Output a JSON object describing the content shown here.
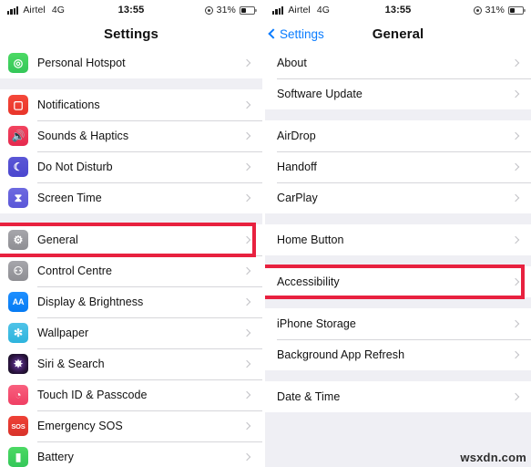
{
  "status_bar": {
    "signal_icon": "cellular-signal-icon",
    "carrier": "Airtel",
    "network": "4G",
    "time": "13:55",
    "location_icon": "location-services-icon",
    "battery_percent": "31%",
    "battery_level": 31,
    "battery_icon": "battery-icon"
  },
  "left_screen": {
    "nav": {
      "title": "Settings"
    },
    "groups": [
      {
        "rows": [
          {
            "label": "Personal Hotspot",
            "icon": "personal-hotspot-icon",
            "icon_class": "ic-hotspot",
            "glyph": "◎",
            "chevron": "chevron-right-icon"
          }
        ]
      },
      {
        "rows": [
          {
            "label": "Notifications",
            "icon": "notifications-icon",
            "icon_class": "ic-notif",
            "glyph": "▢",
            "chevron": "chevron-right-icon"
          },
          {
            "label": "Sounds & Haptics",
            "icon": "sounds-haptics-icon",
            "icon_class": "ic-sounds",
            "glyph": "🔊",
            "chevron": "chevron-right-icon"
          },
          {
            "label": "Do Not Disturb",
            "icon": "do-not-disturb-icon",
            "icon_class": "ic-dnd",
            "glyph": "☾",
            "chevron": "chevron-right-icon"
          },
          {
            "label": "Screen Time",
            "icon": "screen-time-icon",
            "icon_class": "ic-screentime",
            "glyph": "⧗",
            "chevron": "chevron-right-icon"
          }
        ]
      },
      {
        "rows": [
          {
            "label": "General",
            "icon": "general-icon",
            "icon_class": "ic-general",
            "glyph": "⚙",
            "chevron": "chevron-right-icon",
            "highlighted": true
          },
          {
            "label": "Control Centre",
            "icon": "control-centre-icon",
            "icon_class": "ic-control",
            "glyph": "⚇",
            "chevron": "chevron-right-icon"
          },
          {
            "label": "Display & Brightness",
            "icon": "display-brightness-icon",
            "icon_class": "ic-display",
            "glyph": "AA",
            "chevron": "chevron-right-icon"
          },
          {
            "label": "Wallpaper",
            "icon": "wallpaper-icon",
            "icon_class": "ic-wallpaper",
            "glyph": "✻",
            "chevron": "chevron-right-icon"
          },
          {
            "label": "Siri & Search",
            "icon": "siri-search-icon",
            "icon_class": "ic-siri",
            "glyph": "✸",
            "chevron": "chevron-right-icon"
          },
          {
            "label": "Touch ID & Passcode",
            "icon": "touch-id-passcode-icon",
            "icon_class": "ic-touchid",
            "glyph": "◔",
            "chevron": "chevron-right-icon"
          },
          {
            "label": "Emergency SOS",
            "icon": "emergency-sos-icon",
            "icon_class": "ic-sos",
            "glyph": "SOS",
            "chevron": "chevron-right-icon"
          },
          {
            "label": "Battery",
            "icon": "battery-settings-icon",
            "icon_class": "ic-battery",
            "glyph": "▮",
            "chevron": "chevron-right-icon",
            "partial": true
          }
        ]
      }
    ]
  },
  "right_screen": {
    "nav": {
      "back_label": "Settings",
      "back_icon": "chevron-left-icon",
      "title": "General"
    },
    "groups": [
      {
        "rows": [
          {
            "label": "About",
            "chevron": "chevron-right-icon"
          },
          {
            "label": "Software Update",
            "chevron": "chevron-right-icon"
          }
        ]
      },
      {
        "rows": [
          {
            "label": "AirDrop",
            "chevron": "chevron-right-icon"
          },
          {
            "label": "Handoff",
            "chevron": "chevron-right-icon"
          },
          {
            "label": "CarPlay",
            "chevron": "chevron-right-icon"
          }
        ]
      },
      {
        "rows": [
          {
            "label": "Home Button",
            "chevron": "chevron-right-icon"
          }
        ]
      },
      {
        "rows": [
          {
            "label": "Accessibility",
            "chevron": "chevron-right-icon",
            "highlighted": true
          }
        ]
      },
      {
        "rows": [
          {
            "label": "iPhone Storage",
            "chevron": "chevron-right-icon"
          },
          {
            "label": "Background App Refresh",
            "chevron": "chevron-right-icon"
          }
        ]
      },
      {
        "rows": [
          {
            "label": "Date & Time",
            "chevron": "chevron-right-icon",
            "partial": true
          }
        ]
      }
    ]
  },
  "watermark": {
    "text": "wsxdn.com"
  },
  "colors": {
    "highlight": "#e8213f",
    "accent_blue": "#0a7cff",
    "group_background": "#efeff4",
    "row_background": "#ffffff",
    "separator": "#d6d6da",
    "chevron": "#c2c2c6"
  }
}
